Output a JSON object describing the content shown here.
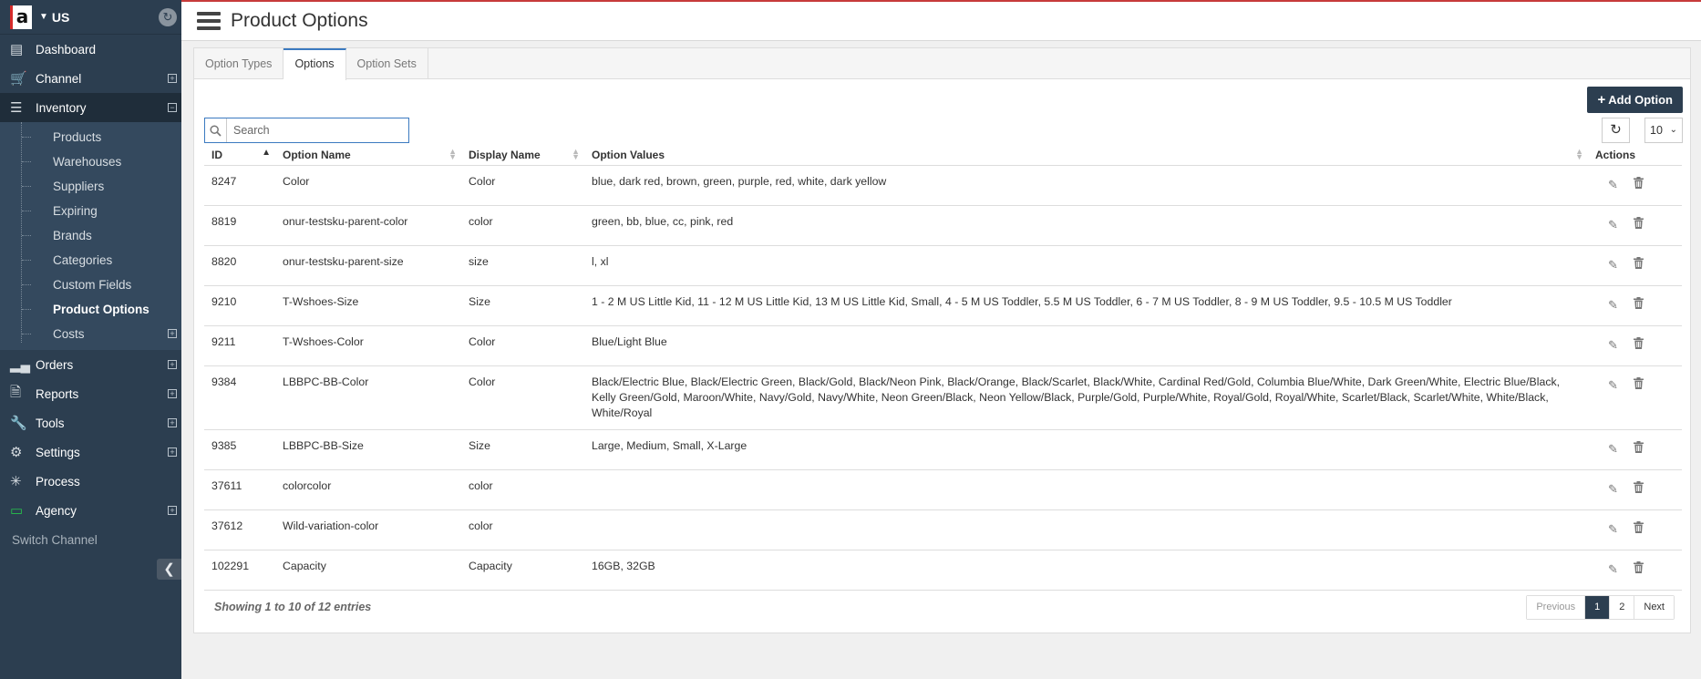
{
  "brand": {
    "logo": "a",
    "region": "US"
  },
  "sidebar": {
    "items": [
      {
        "label": "Dashboard",
        "icon": "bar-chart-icon"
      },
      {
        "label": "Channel",
        "icon": "cart-icon"
      },
      {
        "label": "Inventory",
        "icon": "list-icon"
      }
    ],
    "inventory_children": [
      "Products",
      "Warehouses",
      "Suppliers",
      "Expiring",
      "Brands",
      "Categories",
      "Custom Fields",
      "Product Options",
      "Costs"
    ],
    "items_after": [
      {
        "label": "Orders",
        "icon": "signal-icon"
      },
      {
        "label": "Reports",
        "icon": "file-icon"
      },
      {
        "label": "Tools",
        "icon": "wrench-icon"
      },
      {
        "label": "Settings",
        "icon": "gear-icon"
      },
      {
        "label": "Process",
        "icon": "bug-icon"
      },
      {
        "label": "Agency",
        "icon": "monitor-icon"
      }
    ],
    "switch_channel": "Switch Channel"
  },
  "header": {
    "title": "Product Options"
  },
  "tabs": [
    "Option Types",
    "Options",
    "Option Sets"
  ],
  "toolbar": {
    "add_label": "Add Option",
    "search_placeholder": "Search",
    "page_size": "10"
  },
  "table": {
    "columns": [
      "ID",
      "Option Name",
      "Display Name",
      "Option Values",
      "Actions"
    ],
    "rows": [
      {
        "id": "8247",
        "name": "Color",
        "display": "Color",
        "values": "blue, dark red, brown, green, purple, red, white, dark yellow"
      },
      {
        "id": "8819",
        "name": "onur-testsku-parent-color",
        "display": "color",
        "values": "green, bb, blue, cc, pink, red"
      },
      {
        "id": "8820",
        "name": "onur-testsku-parent-size",
        "display": "size",
        "values": "l, xl"
      },
      {
        "id": "9210",
        "name": "T-Wshoes-Size",
        "display": "Size",
        "values": "1 - 2 M US Little Kid, 11 - 12 M US Little Kid, 13 M US Little Kid, Small, 4 - 5 M US Toddler, 5.5 M US Toddler, 6 - 7 M US Toddler, 8 - 9 M US Toddler, 9.5 - 10.5 M US Toddler"
      },
      {
        "id": "9211",
        "name": "T-Wshoes-Color",
        "display": "Color",
        "values": "Blue/Light Blue"
      },
      {
        "id": "9384",
        "name": "LBBPC-BB-Color",
        "display": "Color",
        "values": "Black/Electric Blue, Black/Electric Green, Black/Gold, Black/Neon Pink, Black/Orange, Black/Scarlet, Black/White, Cardinal Red/Gold, Columbia Blue/White, Dark Green/White, Electric Blue/Black, Kelly Green/Gold, Maroon/White, Navy/Gold, Navy/White, Neon Green/Black, Neon Yellow/Black, Purple/Gold, Purple/White, Royal/Gold, Royal/White, Scarlet/Black, Scarlet/White, White/Black, White/Royal"
      },
      {
        "id": "9385",
        "name": "LBBPC-BB-Size",
        "display": "Size",
        "values": "Large, Medium, Small, X-Large"
      },
      {
        "id": "37611",
        "name": "colorcolor",
        "display": "color",
        "values": ""
      },
      {
        "id": "37612",
        "name": "Wild-variation-color",
        "display": "color",
        "values": ""
      },
      {
        "id": "102291",
        "name": "Capacity",
        "display": "Capacity",
        "values": "16GB, 32GB"
      }
    ]
  },
  "footer": {
    "entries": "Showing 1 to 10 of 12 entries",
    "pager": [
      "Previous",
      "1",
      "2",
      "Next"
    ],
    "current_page": "1"
  },
  "colors": {
    "sidebar": "#2c3e50",
    "accent_red": "#c73a3a",
    "active_tab": "#3b7ac0"
  }
}
